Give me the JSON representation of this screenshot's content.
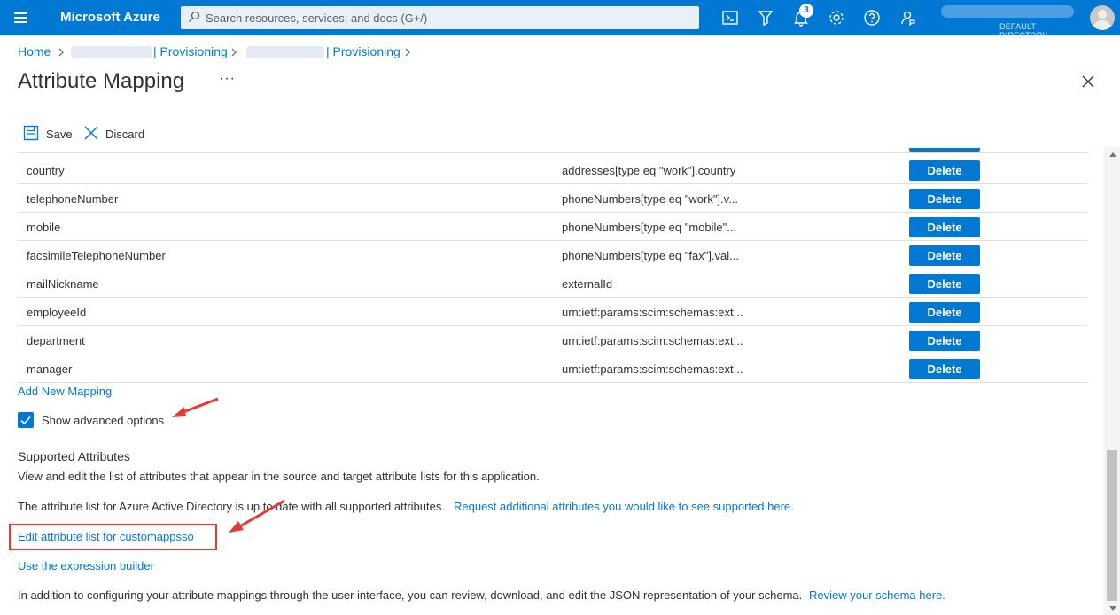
{
  "topbar": {
    "brand": "Microsoft Azure",
    "search_placeholder": "Search resources, services, and docs (G+/)",
    "notification_count": "3",
    "directory_label": "DEFAULT DIRECTORY",
    "icons": [
      "hamburger-icon",
      "search-icon",
      "cloud-shell-icon",
      "directory-filter-icon",
      "bell-icon",
      "gear-icon",
      "help-icon",
      "feedback-icon",
      "avatar"
    ],
    "accent": "#0078d4"
  },
  "breadcrumb": {
    "home": "Home",
    "item1": "| Provisioning",
    "item2": "| Provisioning"
  },
  "page": {
    "title": "Attribute Mapping",
    "more": "···"
  },
  "commands": {
    "save": "Save",
    "discard": "Discard"
  },
  "mappings": [
    {
      "source": "country",
      "target": "addresses[type eq \"work\"].country",
      "action": "Delete"
    },
    {
      "source": "telephoneNumber",
      "target": "phoneNumbers[type eq \"work\"].v...",
      "action": "Delete"
    },
    {
      "source": "mobile",
      "target": "phoneNumbers[type eq \"mobile\"...",
      "action": "Delete"
    },
    {
      "source": "facsimileTelephoneNumber",
      "target": "phoneNumbers[type eq \"fax\"].val...",
      "action": "Delete"
    },
    {
      "source": "mailNickname",
      "target": "externalId",
      "action": "Delete"
    },
    {
      "source": "employeeId",
      "target": "urn:ietf:params:scim:schemas:ext...",
      "action": "Delete"
    },
    {
      "source": "department",
      "target": "urn:ietf:params:scim:schemas:ext...",
      "action": "Delete"
    },
    {
      "source": "manager",
      "target": "urn:ietf:params:scim:schemas:ext...",
      "action": "Delete"
    }
  ],
  "add_mapping": "Add New Mapping",
  "advanced": {
    "label": "Show advanced options",
    "checked": true
  },
  "supported": {
    "title": "Supported Attributes",
    "desc": "View and edit the list of attributes that appear in the source and target attribute lists for this application.",
    "status_text": "The attribute list for Azure Active Directory is up to date with all supported attributes.",
    "request_link": "Request additional attributes you would like to see supported here.",
    "edit_link": "Edit attribute list for customappsso",
    "expression_link": "Use the expression builder",
    "schema_text": "In addition to configuring your attribute mappings through the user interface, you can review, download, and edit the JSON representation of your schema.",
    "schema_link": "Review your schema here."
  },
  "annotation_color": "#e53935"
}
